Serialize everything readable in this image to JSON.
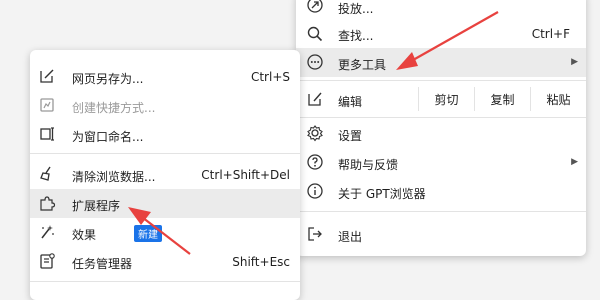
{
  "main_menu": {
    "items": [
      {
        "label": "投放...",
        "shortcut": ""
      },
      {
        "label": "查找...",
        "shortcut": "Ctrl+F"
      },
      {
        "label": "更多工具",
        "shortcut": ""
      },
      {
        "label": "设置",
        "shortcut": ""
      },
      {
        "label": "帮助与反馈",
        "shortcut": ""
      },
      {
        "label": "关于 GPT浏览器",
        "shortcut": ""
      },
      {
        "label": "退出",
        "shortcut": ""
      }
    ],
    "edit": {
      "label": "编辑",
      "cut": "剪切",
      "copy": "复制",
      "paste": "粘贴"
    }
  },
  "sub_menu": {
    "items": [
      {
        "label": "网页另存为...",
        "shortcut": "Ctrl+S"
      },
      {
        "label": "创建快捷方式...",
        "shortcut": ""
      },
      {
        "label": "为窗口命名...",
        "shortcut": ""
      },
      {
        "label": "清除浏览数据...",
        "shortcut": "Ctrl+Shift+Del"
      },
      {
        "label": "扩展程序",
        "shortcut": ""
      },
      {
        "label": "效果",
        "shortcut": "",
        "badge": "新建"
      },
      {
        "label": "任务管理器",
        "shortcut": "Shift+Esc"
      }
    ]
  },
  "colors": {
    "accent": "#1a73e8",
    "arrow": "#e8423f",
    "highlight": "#ebebeb"
  }
}
